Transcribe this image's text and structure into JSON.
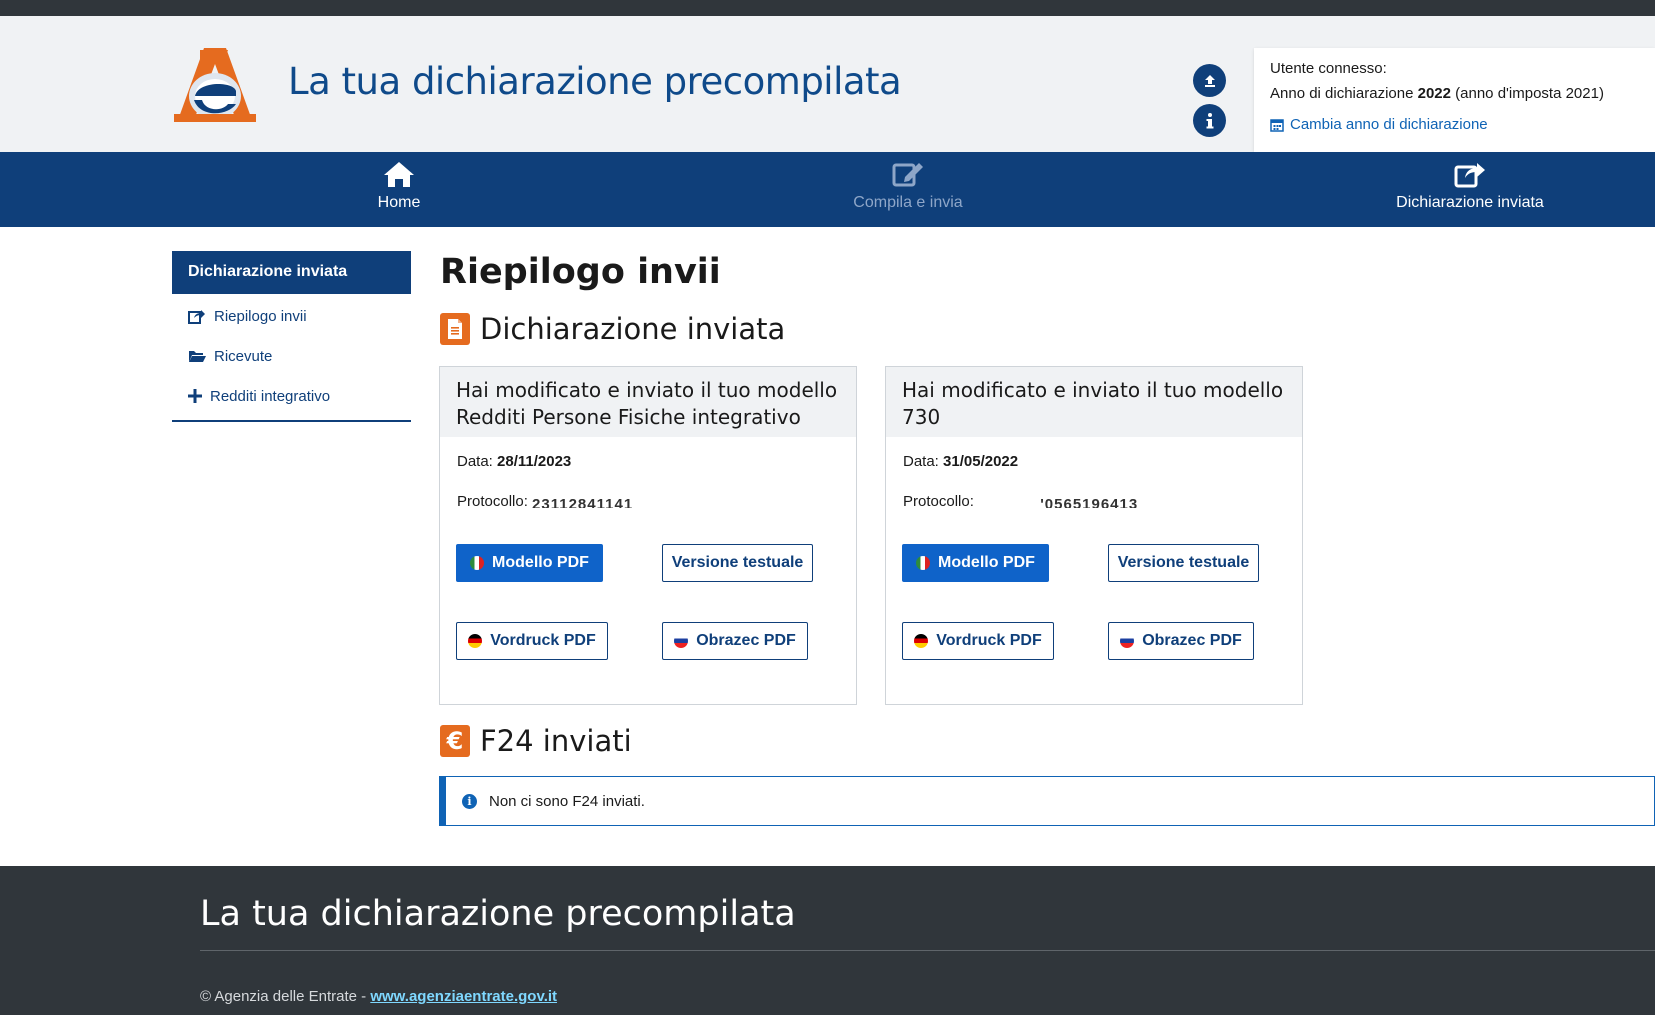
{
  "header": {
    "site_title": "La tua dichiarazione precompilata",
    "user_box": {
      "connected_label": "Utente connesso:",
      "year_prefix": "Anno di dichiarazione",
      "year_value": "2022",
      "year_suffix": "(anno d'imposta 2021)",
      "change_year_link": "Cambia anno di dichiarazione"
    },
    "icons": {
      "upload": "upload-circle-icon",
      "info": "info-circle-icon"
    }
  },
  "nav": {
    "home": "Home",
    "compila": "Compila e invia",
    "inviata": "Dichiarazione inviata"
  },
  "sidebar": {
    "title": "Dichiarazione inviata",
    "items": [
      {
        "label": "Riepilogo invii",
        "icon": "share-icon"
      },
      {
        "label": "Ricevute",
        "icon": "folder-open-icon"
      },
      {
        "label": "Redditi integrativo",
        "icon": "plus-icon"
      }
    ]
  },
  "main": {
    "page_title": "Riepilogo invii",
    "section_dichiarazione": "Dichiarazione inviata",
    "cards": [
      {
        "heading": "Hai modificato e inviato il tuo modello Redditi Persone Fisiche integrativo",
        "date_label": "Data:",
        "date_value": "28/11/2023",
        "protocol_label": "Protocollo:",
        "protocol_value": "23112841141",
        "buttons": {
          "modello": "Modello PDF",
          "versione": "Versione testuale",
          "vordruck": "Vordruck PDF",
          "obrazec": "Obrazec PDF"
        }
      },
      {
        "heading": "Hai modificato e inviato il tuo modello 730",
        "date_label": "Data:",
        "date_value": "31/05/2022",
        "protocol_label": "Protocollo:",
        "protocol_value": "'0565196413",
        "buttons": {
          "modello": "Modello PDF",
          "versione": "Versione testuale",
          "vordruck": "Vordruck PDF",
          "obrazec": "Obrazec PDF"
        }
      }
    ],
    "section_f24": "F24 inviati",
    "f24_alert": "Non ci sono F24 inviati."
  },
  "footer": {
    "title": "La tua dichiarazione precompilata",
    "copyright": "© Agenzia delle Entrate - ",
    "link": "www.agenziaentrate.gov.it"
  },
  "colors": {
    "primary_navy": "#0f3f7a",
    "primary_blue": "#0f63c9",
    "accent_orange": "#e56b1f",
    "footer_bg": "#30363b",
    "header_bg": "#f0f2f4"
  }
}
